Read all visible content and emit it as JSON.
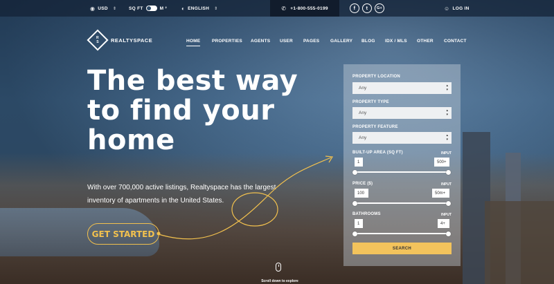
{
  "topbar": {
    "currency": "USD",
    "unit_left": "SQ FT",
    "unit_right": "M ²",
    "language": "ENGLISH",
    "phone": "+1-800-555-0199",
    "social": [
      "f",
      "t",
      "G+"
    ],
    "login": "LOG IN"
  },
  "brand": {
    "name": "REALTYSPACE",
    "mark_top": "R",
    "mark_bottom": "S"
  },
  "nav": [
    "HOME",
    "PROPERTIES",
    "AGENTS",
    "USER",
    "PAGES",
    "GALLERY",
    "BLOG",
    "IDX / MLS",
    "OTHER",
    "CONTACT"
  ],
  "hero": {
    "title_l1": "The best way",
    "title_l2": "to find your",
    "title_l3": "home",
    "subtitle": "With over 700,000 active listings, Realtyspace has the largest inventory of apartments in the United States.",
    "cta": "GET STARTED"
  },
  "search": {
    "location_label": "PROPERTY LOCATION",
    "location_value": "Any",
    "type_label": "PROPERTY TYPE",
    "type_value": "Any",
    "feature_label": "PROPERTY FEATURE",
    "feature_value": "Any",
    "area_label": "BUILT-UP AREA (SQ FT)",
    "area_min": "1",
    "area_max": "500+",
    "price_label": "PRICE ($)",
    "price_min": "100",
    "price_max": "50m+",
    "bath_label": "BATHROOMS",
    "bath_min": "1",
    "bath_max": "4+",
    "input_tag": "INPUT",
    "button": "SEARCH"
  },
  "scroll_hint": "Scroll down to explore",
  "icons": [
    "currency-icon",
    "toggle-icon",
    "globe-icon",
    "phone-icon",
    "facebook-icon",
    "twitter-icon",
    "googleplus-icon",
    "user-icon",
    "mouse-icon"
  ],
  "colors": {
    "accent": "#f2c14e",
    "button": "#f3c35c",
    "topbar": "#14233a"
  }
}
